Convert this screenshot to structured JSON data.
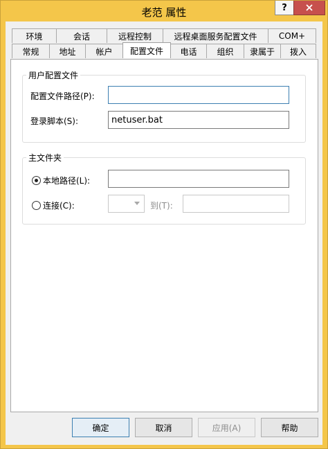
{
  "window": {
    "title": "老范 属性"
  },
  "titlebar": {
    "help_label": "?",
    "close_icon": "close-icon"
  },
  "tabs_row1": [
    "环境",
    "会话",
    "远程控制",
    "远程桌面服务配置文件",
    "COM+"
  ],
  "tabs_row2": [
    "常规",
    "地址",
    "帐户",
    "配置文件",
    "电话",
    "组织",
    "隶属于",
    "拨入"
  ],
  "active_tab": "配置文件",
  "user_profile": {
    "group_label": "用户配置文件",
    "profile_path_label": "配置文件路径(P):",
    "profile_path_value": "",
    "logon_script_label": "登录脚本(S):",
    "logon_script_value": "netuser.bat"
  },
  "home_folder": {
    "group_label": "主文件夹",
    "local_path_label": "本地路径(L):",
    "local_path_value": "",
    "local_path_selected": true,
    "connect_label": "连接(C):",
    "connect_drive_value": "",
    "to_label": "到(T):",
    "to_value": ""
  },
  "buttons": {
    "ok": "确定",
    "cancel": "取消",
    "apply": "应用(A)",
    "help": "帮助"
  }
}
